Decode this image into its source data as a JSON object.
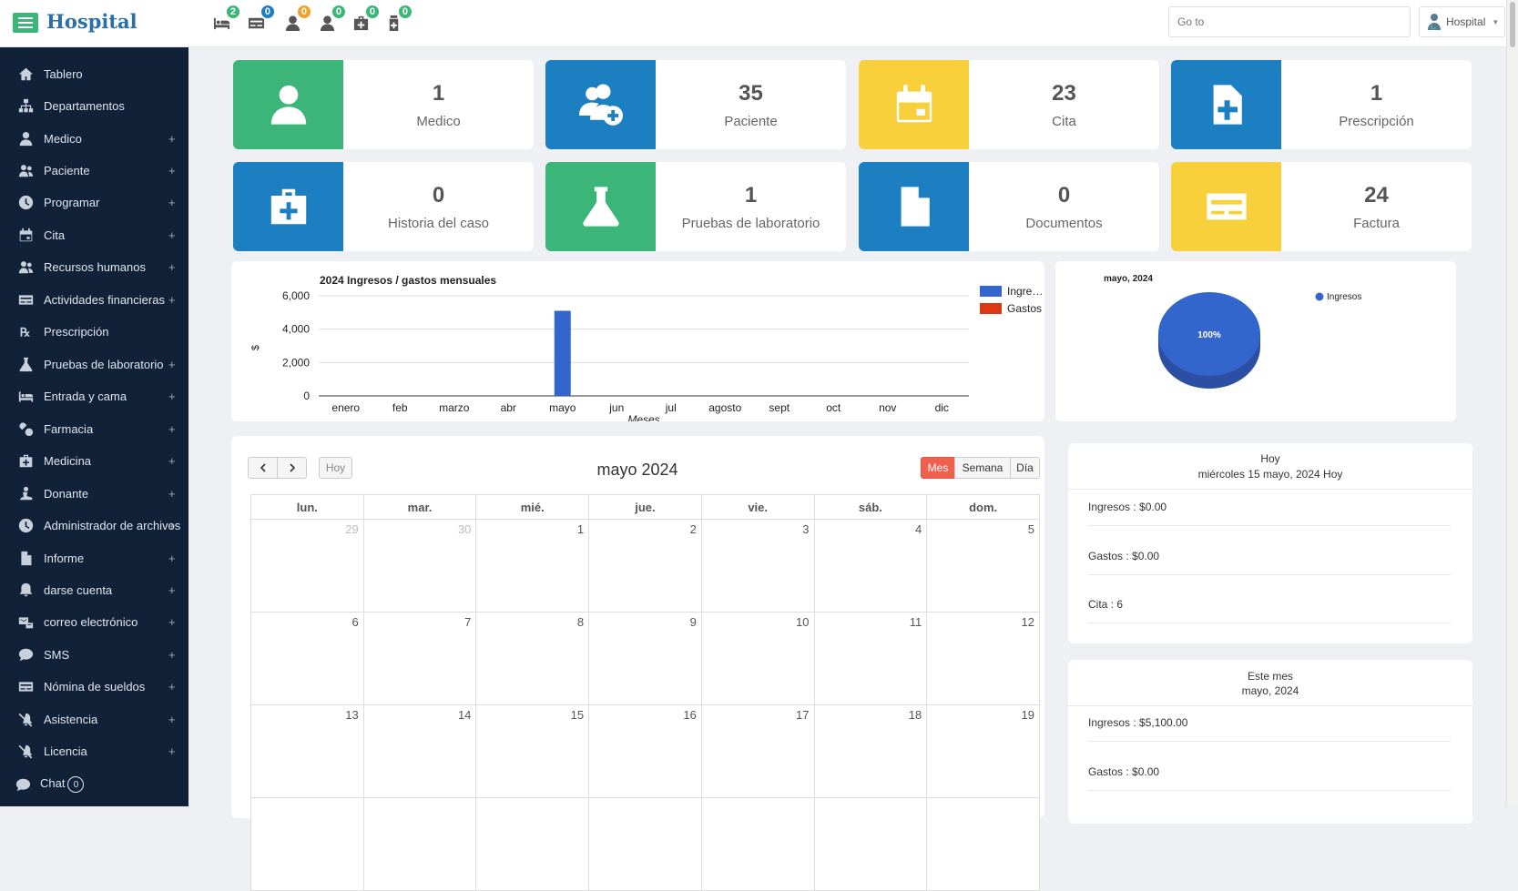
{
  "brand": {
    "name": "Hospital"
  },
  "topbar": {
    "icons": [
      {
        "icon": "bed-icon",
        "badge": "2",
        "color": "#3bb578"
      },
      {
        "icon": "card-icon",
        "badge": "0",
        "color": "#1b7fc2"
      },
      {
        "icon": "user-icon",
        "badge": "0",
        "color": "#f0a22e"
      },
      {
        "icon": "user-icon",
        "badge": "0",
        "color": "#3bb578"
      },
      {
        "icon": "medkit-icon",
        "badge": "0",
        "color": "#3bb578"
      },
      {
        "icon": "medicine-icon",
        "badge": "0",
        "color": "#3bb578"
      }
    ],
    "goto_placeholder": "Go to",
    "user_label": "Hospital"
  },
  "sidebar": {
    "items": [
      {
        "label": "Tablero",
        "icon": "home-icon",
        "plus": ""
      },
      {
        "label": "Departamentos",
        "icon": "sitemap-icon",
        "plus": ""
      },
      {
        "label": "Medico",
        "icon": "doctor-icon",
        "plus": "+"
      },
      {
        "label": "Paciente",
        "icon": "users-icon",
        "plus": "+"
      },
      {
        "label": "Programar",
        "icon": "clock-icon",
        "plus": "+"
      },
      {
        "label": "Cita",
        "icon": "calendar-icon",
        "plus": "+"
      },
      {
        "label": "Recursos humanos",
        "icon": "users-icon",
        "plus": "+"
      },
      {
        "label": "Actividades financieras",
        "icon": "card-icon",
        "plus": "+"
      },
      {
        "label": "Prescripción",
        "icon": "rx-icon",
        "plus": ""
      },
      {
        "label": "Pruebas de laboratorio",
        "icon": "flask-icon",
        "plus": "+"
      },
      {
        "label": "Entrada y cama",
        "icon": "bed-icon",
        "plus": "+"
      },
      {
        "label": "Farmacia",
        "icon": "pills-icon",
        "plus": "+"
      },
      {
        "label": "Medicina",
        "icon": "medkit-icon",
        "plus": "+"
      },
      {
        "label": "Donante",
        "icon": "donor-icon",
        "plus": "+"
      },
      {
        "label": "Administrador de archivos",
        "icon": "clock-icon",
        "plus": "+"
      },
      {
        "label": "Informe",
        "icon": "file-icon",
        "plus": "+"
      },
      {
        "label": "darse cuenta",
        "icon": "bell-icon",
        "plus": "+"
      },
      {
        "label": "correo electrónico",
        "icon": "mail-icon",
        "plus": "+"
      },
      {
        "label": "SMS",
        "icon": "comment-icon",
        "plus": "+"
      },
      {
        "label": "Nómina de sueldos",
        "icon": "card-icon",
        "plus": "+"
      },
      {
        "label": "Asistencia",
        "icon": "bell-slash-icon",
        "plus": "+"
      },
      {
        "label": "Licencia",
        "icon": "bell-slash-icon",
        "plus": "+"
      }
    ],
    "chat": {
      "label": "Chat",
      "count": "0"
    }
  },
  "cards": [
    {
      "value": "1",
      "label": "Medico",
      "icon": "doctor-icon",
      "color": "#3bb578"
    },
    {
      "value": "35",
      "label": "Paciente",
      "icon": "users-plus-icon",
      "color": "#1b7fc2"
    },
    {
      "value": "23",
      "label": "Cita",
      "icon": "calendar-icon",
      "color": "#f7d03c"
    },
    {
      "value": "1",
      "label": "Prescripción",
      "icon": "file-medical-icon",
      "color": "#1b7fc2"
    },
    {
      "value": "0",
      "label": "Historia del caso",
      "icon": "medkit-icon",
      "color": "#1b7fc2"
    },
    {
      "value": "1",
      "label": "Pruebas de laboratorio",
      "icon": "flask-icon",
      "color": "#3bb578"
    },
    {
      "value": "0",
      "label": "Documentos",
      "icon": "file-icon",
      "color": "#1b7fc2"
    },
    {
      "value": "24",
      "label": "Factura",
      "icon": "card-icon",
      "color": "#f7d03c"
    }
  ],
  "chart_data": [
    {
      "type": "bar",
      "title": "2024 Ingresos / gastos mensuales",
      "xlabel": "Meses",
      "ylabel": "$",
      "categories": [
        "enero",
        "feb",
        "marzo",
        "abr",
        "mayo",
        "jun",
        "jul",
        "agosto",
        "sept",
        "oct",
        "nov",
        "dic"
      ],
      "series": [
        {
          "name": "Ingre…",
          "color": "#3366cc",
          "values": [
            0,
            0,
            0,
            0,
            5100,
            0,
            0,
            0,
            0,
            0,
            0,
            0
          ]
        },
        {
          "name": "Gastos",
          "color": "#dc3912",
          "values": [
            0,
            0,
            0,
            0,
            0,
            0,
            0,
            0,
            0,
            0,
            0,
            0
          ]
        }
      ],
      "ylim": [
        0,
        6000
      ],
      "yticks": [
        "6,000",
        "4,000",
        "2,000",
        "0"
      ],
      "grid": true,
      "legend": "right"
    },
    {
      "type": "pie",
      "title": "mayo, 2024",
      "slices": [
        {
          "name": "Ingresos",
          "value": 100,
          "label": "100%",
          "color": "#3366cc"
        }
      ],
      "legend": "top-right"
    }
  ],
  "calendar": {
    "title": "mayo 2024",
    "today_label": "Hoy",
    "views": [
      "Mes",
      "Semana",
      "Día"
    ],
    "weekdays": [
      "lun.",
      "mar.",
      "mié.",
      "jue.",
      "vie.",
      "sáb.",
      "dom."
    ],
    "weeks": [
      [
        {
          "d": "29",
          "other": true
        },
        {
          "d": "30",
          "other": true
        },
        {
          "d": "1"
        },
        {
          "d": "2"
        },
        {
          "d": "3"
        },
        {
          "d": "4"
        },
        {
          "d": "5"
        }
      ],
      [
        {
          "d": "6"
        },
        {
          "d": "7"
        },
        {
          "d": "8"
        },
        {
          "d": "9"
        },
        {
          "d": "10"
        },
        {
          "d": "11"
        },
        {
          "d": "12"
        }
      ],
      [
        {
          "d": "13"
        },
        {
          "d": "14"
        },
        {
          "d": "15"
        },
        {
          "d": "16"
        },
        {
          "d": "17"
        },
        {
          "d": "18"
        },
        {
          "d": "19"
        }
      ]
    ]
  },
  "today_panel": {
    "title": "Hoy",
    "subtitle": "miércoles 15 mayo, 2024 Hoy",
    "rows": [
      "Ingresos : $0.00",
      "Gastos : $0.00",
      "Cita : 6"
    ]
  },
  "month_panel": {
    "title": "Este mes",
    "subtitle": "mayo, 2024",
    "rows": [
      "Ingresos : $5,100.00",
      "Gastos : $0.00"
    ]
  }
}
